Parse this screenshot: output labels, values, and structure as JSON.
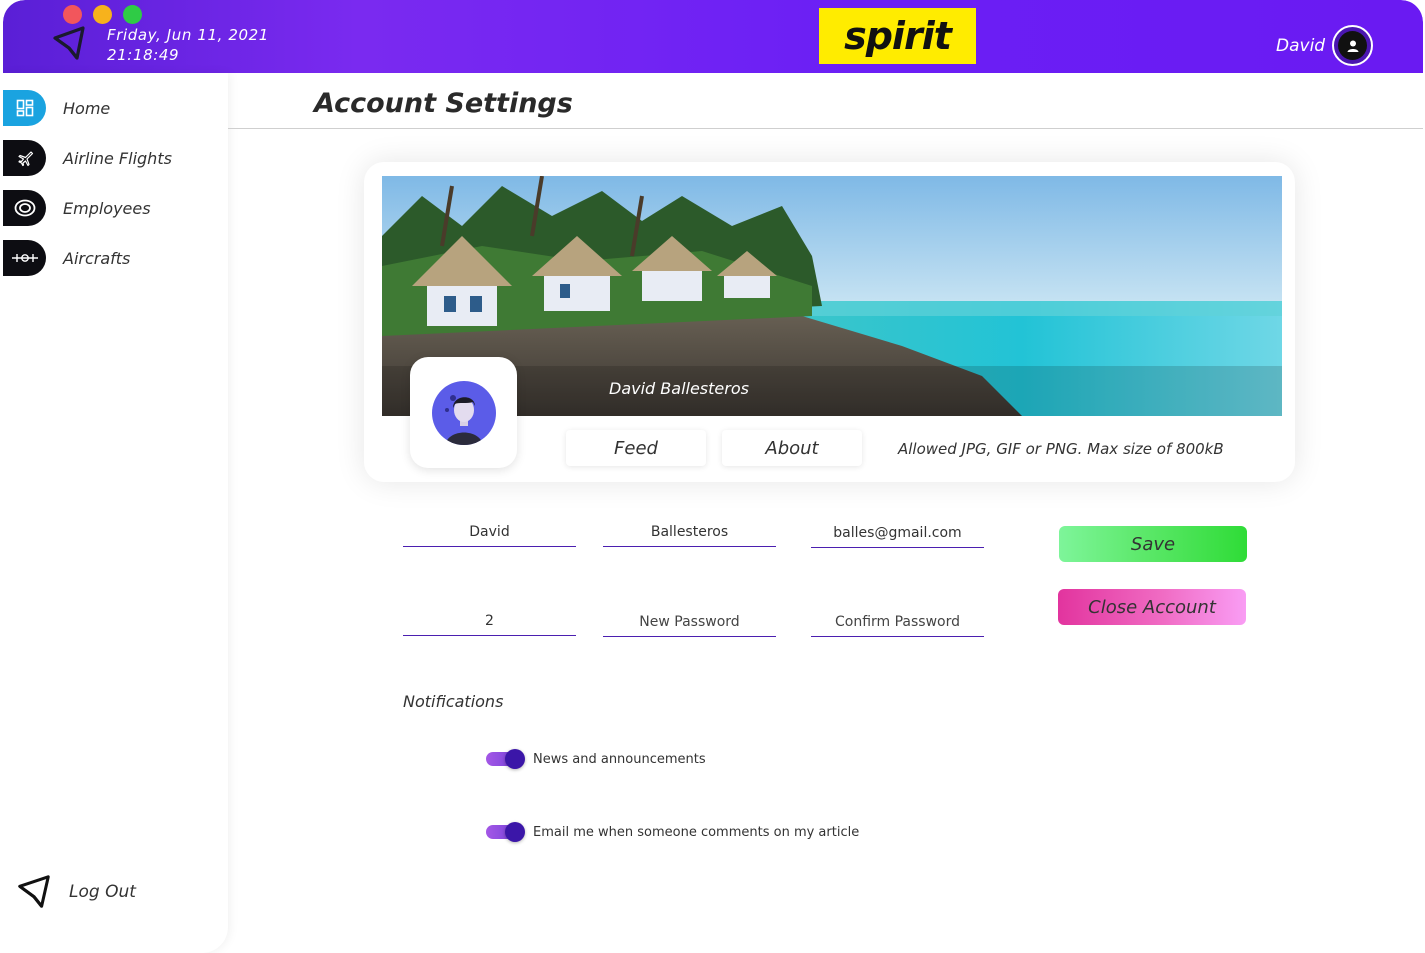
{
  "header": {
    "date": "Friday, Jun 11, 2021",
    "time": "21:18:49",
    "brand": "spirit",
    "user_name": "David",
    "accent_color": "#6b1ff5",
    "brand_color": "#ffec00"
  },
  "sidebar": {
    "items": [
      {
        "label": "Home",
        "icon": "dashboard-icon",
        "active": true
      },
      {
        "label": "Airline Flights",
        "icon": "airplane-icon",
        "active": false
      },
      {
        "label": "Employees",
        "icon": "employees-icon",
        "active": false
      },
      {
        "label": "Aircrafts",
        "icon": "aircraft-icon",
        "active": false
      }
    ],
    "logout_label": "Log Out"
  },
  "main": {
    "title": "Account Settings",
    "profile": {
      "cover_name": "David Ballesteros",
      "tabs": [
        "Feed",
        "About"
      ],
      "upload_hint": "Allowed JPG, GIF or PNG. Max size of 800kB"
    },
    "form": {
      "first_name": "David",
      "last_name": "Ballesteros",
      "email": "balles@gmail.com",
      "current_password": "2",
      "new_password_placeholder": "New Password",
      "confirm_password_placeholder": "Confirm Password",
      "save_label": "Save",
      "close_account_label": "Close Account"
    },
    "notifications": {
      "heading": "Notifications",
      "options": [
        {
          "label": "News and announcements",
          "enabled": true
        },
        {
          "label": "Email me when someone comments on my article",
          "enabled": true
        }
      ]
    }
  }
}
